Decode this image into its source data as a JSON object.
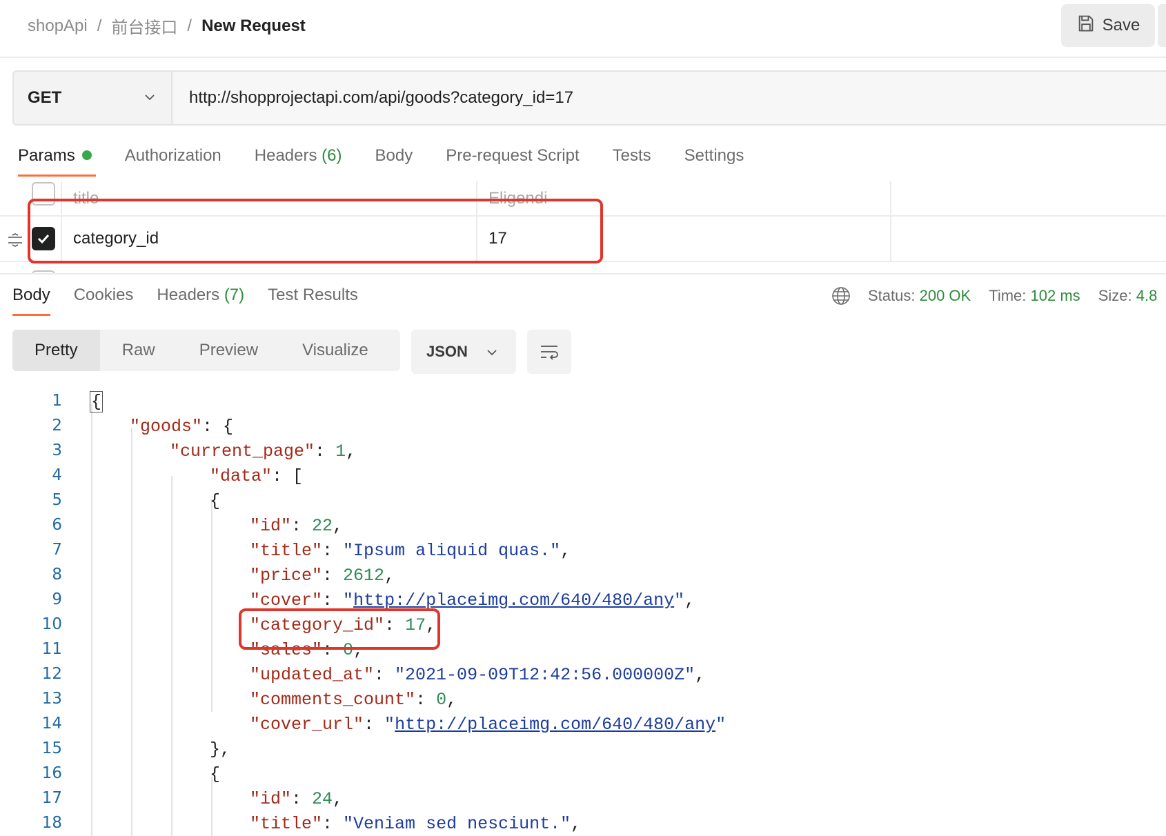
{
  "breadcrumb": {
    "workspace": "shopApi",
    "folder": "前台接口",
    "request": "New Request",
    "separator": "/"
  },
  "header": {
    "save_label": "Save",
    "save_icon": "save-icon"
  },
  "request": {
    "method": "GET",
    "url": "http://shopprojectapi.com/api/goods?category_id=17"
  },
  "request_tabs": [
    {
      "label": "Params",
      "active": true,
      "indicator": "green-dot"
    },
    {
      "label": "Authorization"
    },
    {
      "label": "Headers",
      "count": "(6)"
    },
    {
      "label": "Body"
    },
    {
      "label": "Pre-request Script"
    },
    {
      "label": "Tests"
    },
    {
      "label": "Settings"
    }
  ],
  "params": {
    "header": {
      "key": "title",
      "value": "Eligendi"
    },
    "rows": [
      {
        "checked": true,
        "key": "category_id",
        "value": "17"
      }
    ]
  },
  "response_tabs": [
    {
      "label": "Body",
      "active": true
    },
    {
      "label": "Cookies"
    },
    {
      "label": "Headers",
      "count": "(7)"
    },
    {
      "label": "Test Results"
    }
  ],
  "response_meta": {
    "status_label": "Status:",
    "status_value": "200 OK",
    "time_label": "Time:",
    "time_value": "102 ms",
    "size_label": "Size:",
    "size_value": "4.8"
  },
  "view_modes": [
    "Pretty",
    "Raw",
    "Preview",
    "Visualize"
  ],
  "active_view_mode": "Pretty",
  "format": "JSON",
  "code": {
    "line_numbers": [
      "1",
      "2",
      "3",
      "4",
      "5",
      "6",
      "7",
      "8",
      "9",
      "10",
      "11",
      "12",
      "13",
      "14",
      "15",
      "16",
      "17",
      "18"
    ],
    "lines": [
      [
        {
          "t": "p",
          "v": "{"
        }
      ],
      [
        {
          "t": "k",
          "v": "\"goods\""
        },
        {
          "t": "p",
          "v": ": {"
        }
      ],
      [
        {
          "t": "k",
          "v": "\"current_page\""
        },
        {
          "t": "p",
          "v": ": "
        },
        {
          "t": "n",
          "v": "1"
        },
        {
          "t": "p",
          "v": ","
        }
      ],
      [
        {
          "t": "k",
          "v": "\"data\""
        },
        {
          "t": "p",
          "v": ": ["
        }
      ],
      [
        {
          "t": "p",
          "v": "{"
        }
      ],
      [
        {
          "t": "k",
          "v": "\"id\""
        },
        {
          "t": "p",
          "v": ": "
        },
        {
          "t": "n",
          "v": "22"
        },
        {
          "t": "p",
          "v": ","
        }
      ],
      [
        {
          "t": "k",
          "v": "\"title\""
        },
        {
          "t": "p",
          "v": ": "
        },
        {
          "t": "s",
          "v": "\"Ipsum aliquid quas.\""
        },
        {
          "t": "p",
          "v": ","
        }
      ],
      [
        {
          "t": "k",
          "v": "\"price\""
        },
        {
          "t": "p",
          "v": ": "
        },
        {
          "t": "n",
          "v": "2612"
        },
        {
          "t": "p",
          "v": ","
        }
      ],
      [
        {
          "t": "k",
          "v": "\"cover\""
        },
        {
          "t": "p",
          "v": ": "
        },
        {
          "t": "s",
          "v": "\""
        },
        {
          "t": "l",
          "v": "http://placeimg.com/640/480/any"
        },
        {
          "t": "s",
          "v": "\""
        },
        {
          "t": "p",
          "v": ","
        }
      ],
      [
        {
          "t": "k",
          "v": "\"category_id\""
        },
        {
          "t": "p",
          "v": ": "
        },
        {
          "t": "n",
          "v": "17"
        },
        {
          "t": "p",
          "v": ","
        }
      ],
      [
        {
          "t": "k",
          "v": "\"sales\""
        },
        {
          "t": "p",
          "v": ": "
        },
        {
          "t": "n",
          "v": "0"
        },
        {
          "t": "p",
          "v": ","
        }
      ],
      [
        {
          "t": "k",
          "v": "\"updated_at\""
        },
        {
          "t": "p",
          "v": ": "
        },
        {
          "t": "s",
          "v": "\"2021-09-09T12:42:56.000000Z\""
        },
        {
          "t": "p",
          "v": ","
        }
      ],
      [
        {
          "t": "k",
          "v": "\"comments_count\""
        },
        {
          "t": "p",
          "v": ": "
        },
        {
          "t": "n",
          "v": "0"
        },
        {
          "t": "p",
          "v": ","
        }
      ],
      [
        {
          "t": "k",
          "v": "\"cover_url\""
        },
        {
          "t": "p",
          "v": ": "
        },
        {
          "t": "s",
          "v": "\""
        },
        {
          "t": "l",
          "v": "http://placeimg.com/640/480/any"
        },
        {
          "t": "s",
          "v": "\""
        }
      ],
      [
        {
          "t": "p",
          "v": "},"
        }
      ],
      [
        {
          "t": "p",
          "v": "{"
        }
      ],
      [
        {
          "t": "k",
          "v": "\"id\""
        },
        {
          "t": "p",
          "v": ": "
        },
        {
          "t": "n",
          "v": "24"
        },
        {
          "t": "p",
          "v": ","
        }
      ],
      [
        {
          "t": "k",
          "v": "\"title\""
        },
        {
          "t": "p",
          "v": ": "
        },
        {
          "t": "s",
          "v": "\"Veniam sed nesciunt.\""
        },
        {
          "t": "p",
          "v": ","
        }
      ]
    ]
  },
  "colors": {
    "accent": "#ff6c37",
    "highlight_box": "#e0352b",
    "success": "#2f8b3d",
    "json_key": "#a32a19",
    "json_string": "#1d3d9e",
    "json_number": "#2e8b57",
    "line_number": "#1f6aa5"
  }
}
